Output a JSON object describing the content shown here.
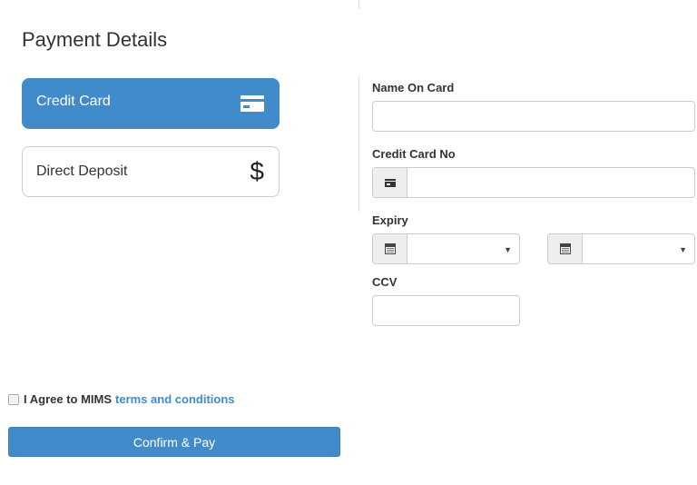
{
  "page": {
    "title": "Payment Details"
  },
  "payment_methods": [
    {
      "label": "Credit Card",
      "icon": "credit-card-icon",
      "selected": true
    },
    {
      "label": "Direct Deposit",
      "icon": "dollar-icon",
      "selected": false,
      "glyph": "$"
    }
  ],
  "form": {
    "name_on_card": {
      "label": "Name On Card",
      "value": "",
      "placeholder": ""
    },
    "card_number": {
      "label": "Credit Card No",
      "value": "",
      "placeholder": "",
      "addon_icon": "credit-card-icon"
    },
    "expiry": {
      "label": "Expiry",
      "month": {
        "selected": "",
        "addon_icon": "calendar-icon",
        "caret": "▼"
      },
      "year": {
        "selected": "",
        "addon_icon": "calendar-icon",
        "caret": "▼"
      }
    },
    "ccv": {
      "label": "CCV",
      "value": "",
      "placeholder": ""
    }
  },
  "agreement": {
    "checked": false,
    "text": "I Agree to MIMS",
    "link_text": "terms and conditions"
  },
  "actions": {
    "confirm_label": "Confirm & Pay"
  },
  "colors": {
    "primary": "#428bca",
    "border": "#cccccc",
    "addon_bg": "#eeeeee",
    "text": "#333333"
  }
}
